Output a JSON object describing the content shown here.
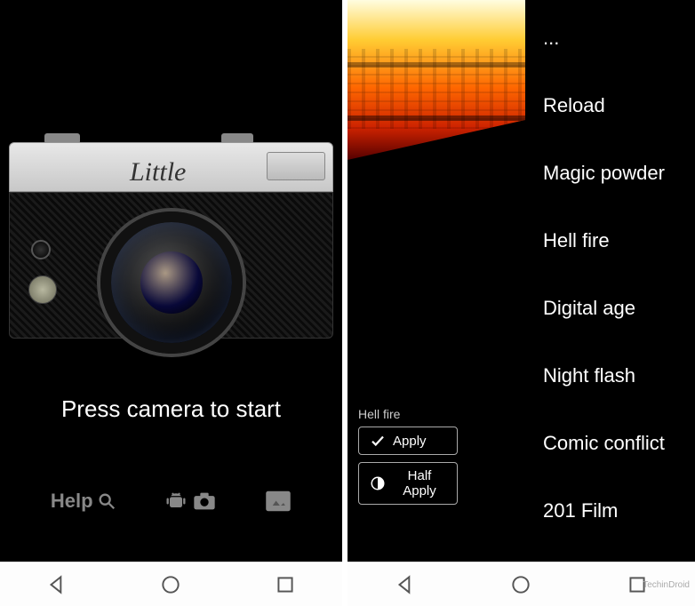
{
  "left": {
    "camera_brand": "Little",
    "start_text": "Press camera to start",
    "toolbar": {
      "help_label": "Help",
      "help_icon": "search-icon",
      "android_icon": "android-icon",
      "camera_icon": "camera-icon",
      "gallery_icon": "gallery-icon"
    }
  },
  "right": {
    "filters": [
      "...",
      "Reload",
      "Magic powder",
      "Hell fire",
      "Digital age",
      "Night flash",
      "Comic conflict",
      "201 Film"
    ],
    "selected_filter": "Hell fire",
    "apply_label": "Apply",
    "half_apply_label": "Half Apply"
  },
  "nav": {
    "back_icon": "triangle-back",
    "home_icon": "circle-home",
    "recent_icon": "square-recent"
  },
  "watermark": "TechinDroid"
}
